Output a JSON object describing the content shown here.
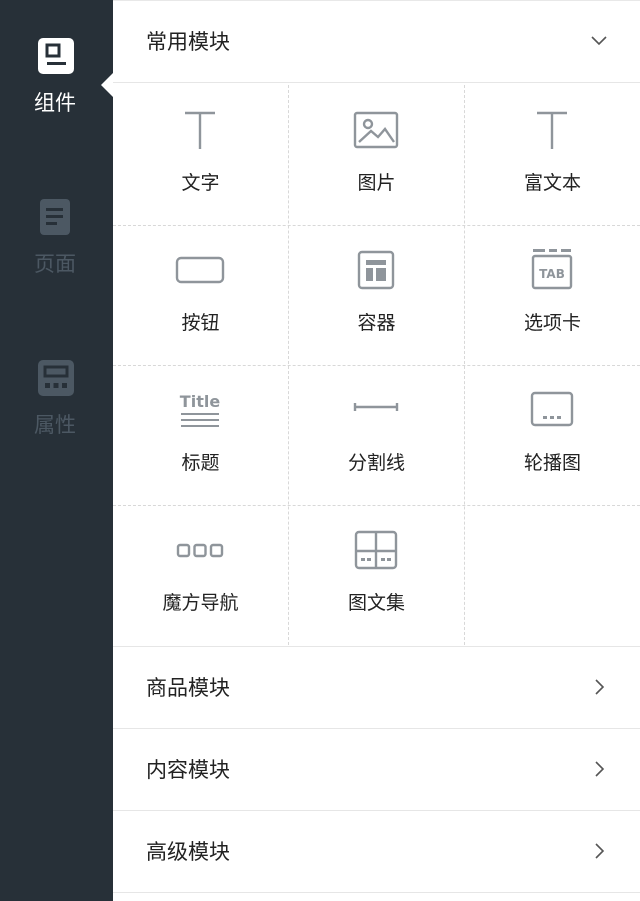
{
  "sidebar": {
    "items": [
      {
        "label": "组件",
        "icon": "component-icon",
        "active": true
      },
      {
        "label": "页面",
        "icon": "page-icon",
        "active": false
      },
      {
        "label": "属性",
        "icon": "property-icon",
        "active": false
      }
    ]
  },
  "sections": {
    "common": {
      "title": "常用模块",
      "expanded": true
    },
    "goods": {
      "title": "商品模块",
      "expanded": false
    },
    "content": {
      "title": "内容模块",
      "expanded": false
    },
    "advanced": {
      "title": "高级模块",
      "expanded": false
    }
  },
  "components": [
    {
      "label": "文字",
      "icon": "text-icon"
    },
    {
      "label": "图片",
      "icon": "image-icon"
    },
    {
      "label": "富文本",
      "icon": "rich-text-icon"
    },
    {
      "label": "按钮",
      "icon": "button-icon"
    },
    {
      "label": "容器",
      "icon": "container-icon"
    },
    {
      "label": "选项卡",
      "icon": "tab-icon"
    },
    {
      "label": "标题",
      "icon": "title-icon"
    },
    {
      "label": "分割线",
      "icon": "divider-icon"
    },
    {
      "label": "轮播图",
      "icon": "carousel-icon"
    },
    {
      "label": "魔方导航",
      "icon": "cube-nav-icon"
    },
    {
      "label": "图文集",
      "icon": "image-text-icon"
    }
  ],
  "icon_text": {
    "tab": "TAB",
    "title": "Title"
  },
  "colors": {
    "sidebar_bg": "#273038",
    "active_text": "#ffffff",
    "inactive_text": "#4c5863",
    "icon_gray": "#8f959b"
  }
}
